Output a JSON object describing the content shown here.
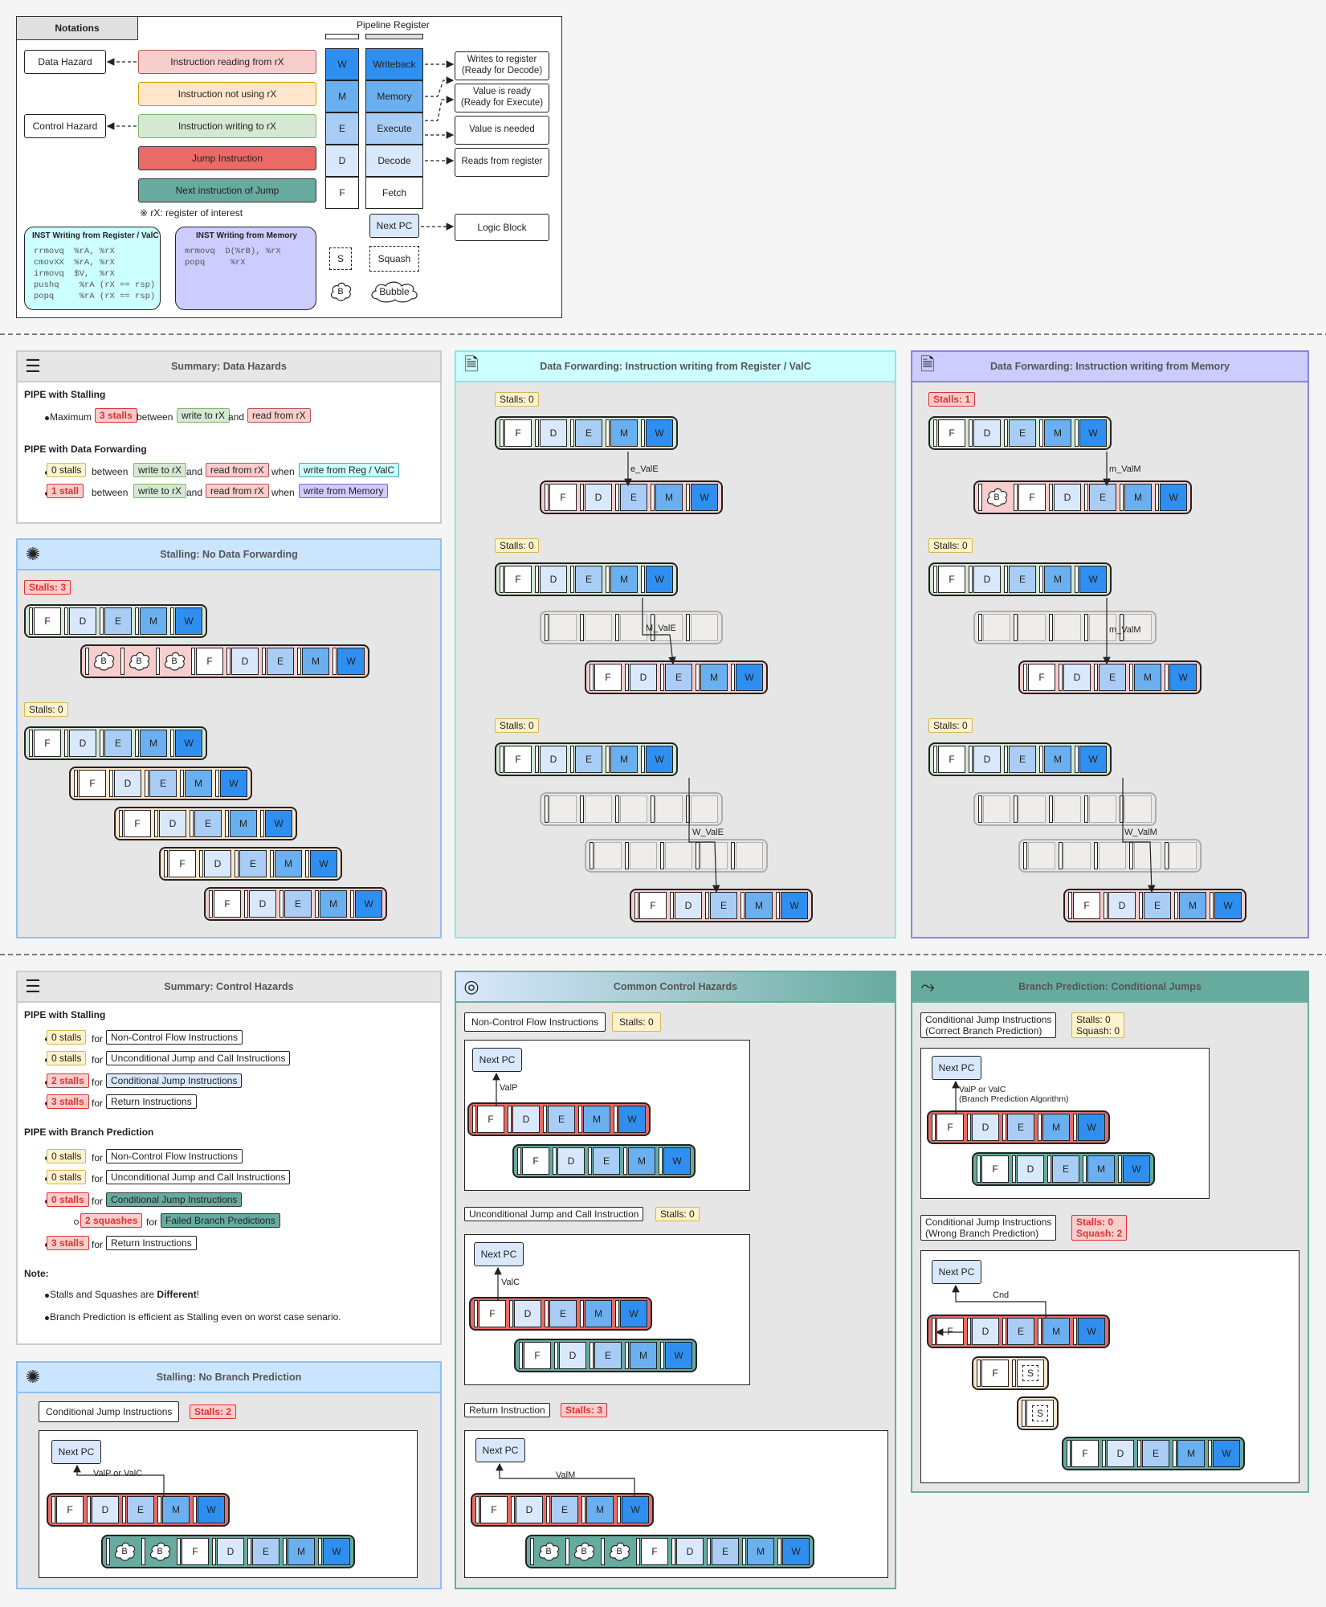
{
  "notations": {
    "title": "Notations",
    "pipeline_register": "Pipeline Register",
    "data_hazard": "Data Hazard",
    "control_hazard": "Control Hazard",
    "inst_reading": "Instruction reading from rX",
    "inst_not_using": "Instruction not using rX",
    "inst_writing": "Instruction writing to rX",
    "jump_inst": "Jump Instruction",
    "next_inst": "Next instruction of Jump",
    "rx_note": "※ rX: register of interest",
    "stages": [
      {
        "letter": "W",
        "name": "Writeback",
        "desc": "Writes to register\n(Ready for Decode)"
      },
      {
        "letter": "M",
        "name": "Memory",
        "desc": "Value is ready\n(Ready for Execute)"
      },
      {
        "letter": "E",
        "name": "Execute",
        "desc": "Value is needed"
      },
      {
        "letter": "D",
        "name": "Decode",
        "desc": "Reads from register"
      },
      {
        "letter": "F",
        "name": "Fetch",
        "desc": ""
      }
    ],
    "next_pc": "Next PC",
    "logic_block": "Logic Block",
    "s": "S",
    "squash": "Squash",
    "b": "B",
    "bubble": "Bubble",
    "inst_reg_title": "INST Writing from Register / ValC",
    "inst_reg_code": "rrmovq  %rA, %rX\ncmovXX  %rA, %rX\nirmovq  $V,  %rX\npushq    %rA (rX == rsp)\npopq     %rA (rX == rsp)",
    "inst_mem_title": "INST Writing from Memory",
    "inst_mem_code": "mrmovq  D(%rB), %rX\npopq     %rX"
  },
  "summary_data": {
    "title": "Summary: Data Hazards",
    "stalling_heading": "PIPE with Stalling",
    "maximum": "Maximum",
    "three_stalls": "3 stalls",
    "between": "between",
    "write_to_rx": "write to rX",
    "and": "and",
    "read_from_rx": "read from rX",
    "forwarding_heading": "PIPE with Data Forwarding",
    "zero_stalls": "0 stalls",
    "one_stall": "1 stall",
    "when": "when",
    "write_from_reg": "write from Reg / ValC",
    "write_from_mem": "write from Memory"
  },
  "stalling_no_fwd": {
    "title": "Stalling: No Data Forwarding",
    "stalls3": "Stalls: 3",
    "stalls0": "Stalls: 0"
  },
  "fwd_reg": {
    "title": "Data Forwarding: Instruction writing from Register / ValC",
    "stalls": "Stalls: 0",
    "labels": [
      "e_ValE",
      "M_ValE",
      "W_ValE"
    ]
  },
  "fwd_mem": {
    "title": "Data Forwarding: Instruction writing from Memory",
    "stalls1": "Stalls: 1",
    "stalls0": "Stalls: 0",
    "labels": [
      "m_ValM",
      "m_ValM",
      "W_ValM"
    ]
  },
  "summary_control": {
    "title": "Summary: Control Hazards",
    "stalling_heading": "PIPE with Stalling",
    "bp_heading": "PIPE with Branch Prediction",
    "for": "for",
    "zero_stalls": "0 stalls",
    "two_stalls": "2 stalls",
    "three_stalls": "3 stalls",
    "two_squashes": "2 squashes",
    "non_control": "Non-Control Flow Instructions",
    "uncond": "Unconditional Jump and Call Instructions",
    "cond": "Conditional Jump Instructions",
    "ret": "Return Instructions",
    "failed": "Failed Branch Predictions",
    "note": "Note:",
    "note1_pre": "Stalls and Squashes are ",
    "note1_bold": "Different",
    "note1_post": "!",
    "note2": "Branch Prediction is efficient as Stalling even on worst case senario."
  },
  "stalling_no_bp": {
    "title": "Stalling: No Branch Prediction",
    "label": "Conditional Jump Instructions",
    "stalls": "Stalls: 2",
    "next_pc": "Next PC",
    "arrow": "ValP or ValC"
  },
  "common_control": {
    "title": "Common Control Hazards",
    "nc_label": "Non-Control Flow Instructions",
    "nc_stalls": "Stalls: 0",
    "nc_arrow": "ValP",
    "uj_label": "Unconditional Jump and Call Instruction",
    "uj_stalls": "Stalls: 0",
    "uj_arrow": "ValC",
    "ret_label": "Return Instruction",
    "ret_stalls": "Stalls: 3",
    "ret_arrow": "ValM",
    "next_pc": "Next PC"
  },
  "branch_pred": {
    "title": "Branch Prediction: Conditional Jumps",
    "correct_label": "Conditional Jump Instructions\n(Correct Branch Prediction)",
    "correct_stalls": "Stalls: 0\nSquash: 0",
    "correct_arrow": "ValP or ValC\n(Branch Prediction Algorithm)",
    "wrong_label": "Conditional Jump Instructions\n(Wrong Branch Prediction)",
    "wrong_stalls": "Stalls: 0",
    "wrong_squash": "Squash: 2",
    "wrong_arrow": "Cnd",
    "next_pc": "Next PC"
  },
  "letters": {
    "F": "F",
    "D": "D",
    "E": "E",
    "M": "M",
    "W": "W",
    "B": "B",
    "S": "S"
  },
  "colors": {
    "red_row": "#f8cecc",
    "green_row": "#d5e8d4",
    "orange_row": "#ffe6cc",
    "jump_row": "#ea6b66",
    "next_row": "#67ab9f",
    "cyan": "#ccffff",
    "lavender": "#ccccff",
    "blue_panel": "#cce5ff"
  }
}
